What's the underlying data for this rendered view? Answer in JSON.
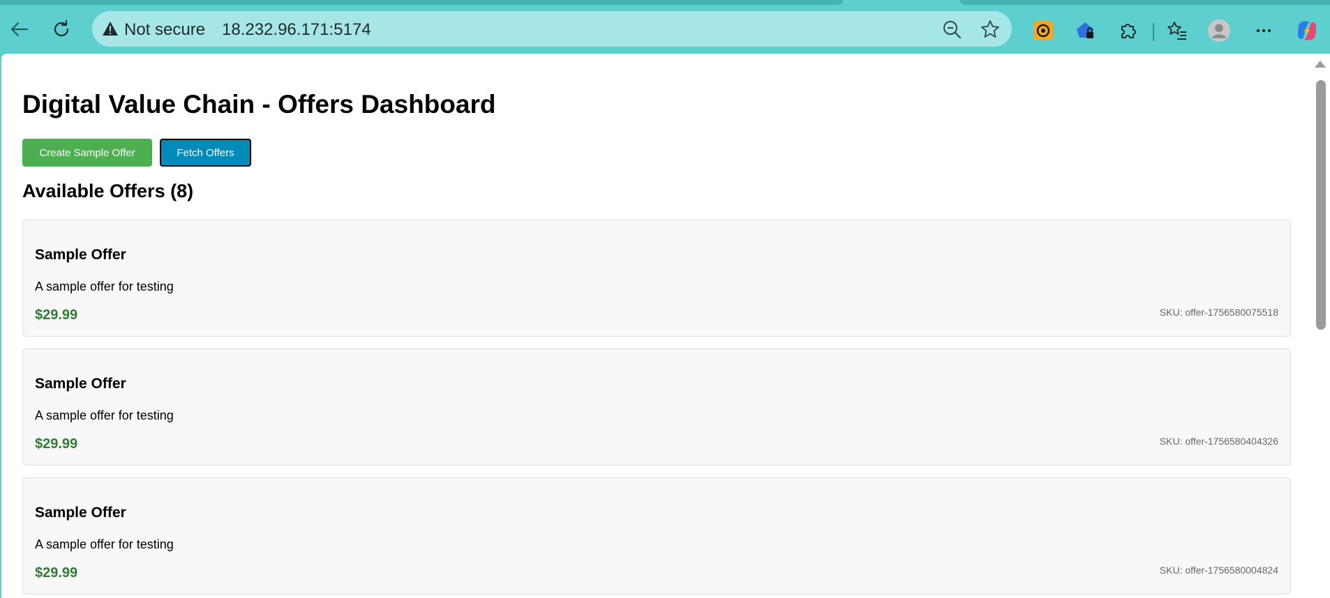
{
  "browser": {
    "security_label": "Not secure",
    "url": "18.232.96.171:5174"
  },
  "page": {
    "title": "Digital Value Chain - Offers Dashboard",
    "create_button_label": "Create Sample Offer",
    "fetch_button_label": "Fetch Offers",
    "section_title": "Available Offers (8)"
  },
  "offers": [
    {
      "name": "Sample Offer",
      "description": "A sample offer for testing",
      "price": "$29.99",
      "sku": "SKU: offer-1756580075518"
    },
    {
      "name": "Sample Offer",
      "description": "A sample offer for testing",
      "price": "$29.99",
      "sku": "SKU: offer-1756580404326"
    },
    {
      "name": "Sample Offer",
      "description": "A sample offer for testing",
      "price": "$29.99",
      "sku": "SKU: offer-1756580004824"
    }
  ],
  "colors": {
    "create_button": "#4caf50",
    "fetch_button": "#008cba",
    "price": "#2e7d32",
    "browser_chrome": "#5ecfcf"
  },
  "icons": [
    "back-arrow-icon",
    "refresh-icon",
    "warning-icon",
    "zoom-out-icon",
    "favorite-star-icon",
    "extension-wallet-icon",
    "extension-lock-icon",
    "extensions-puzzle-icon",
    "favorites-list-icon",
    "profile-avatar-icon",
    "more-options-icon",
    "copilot-icon"
  ]
}
